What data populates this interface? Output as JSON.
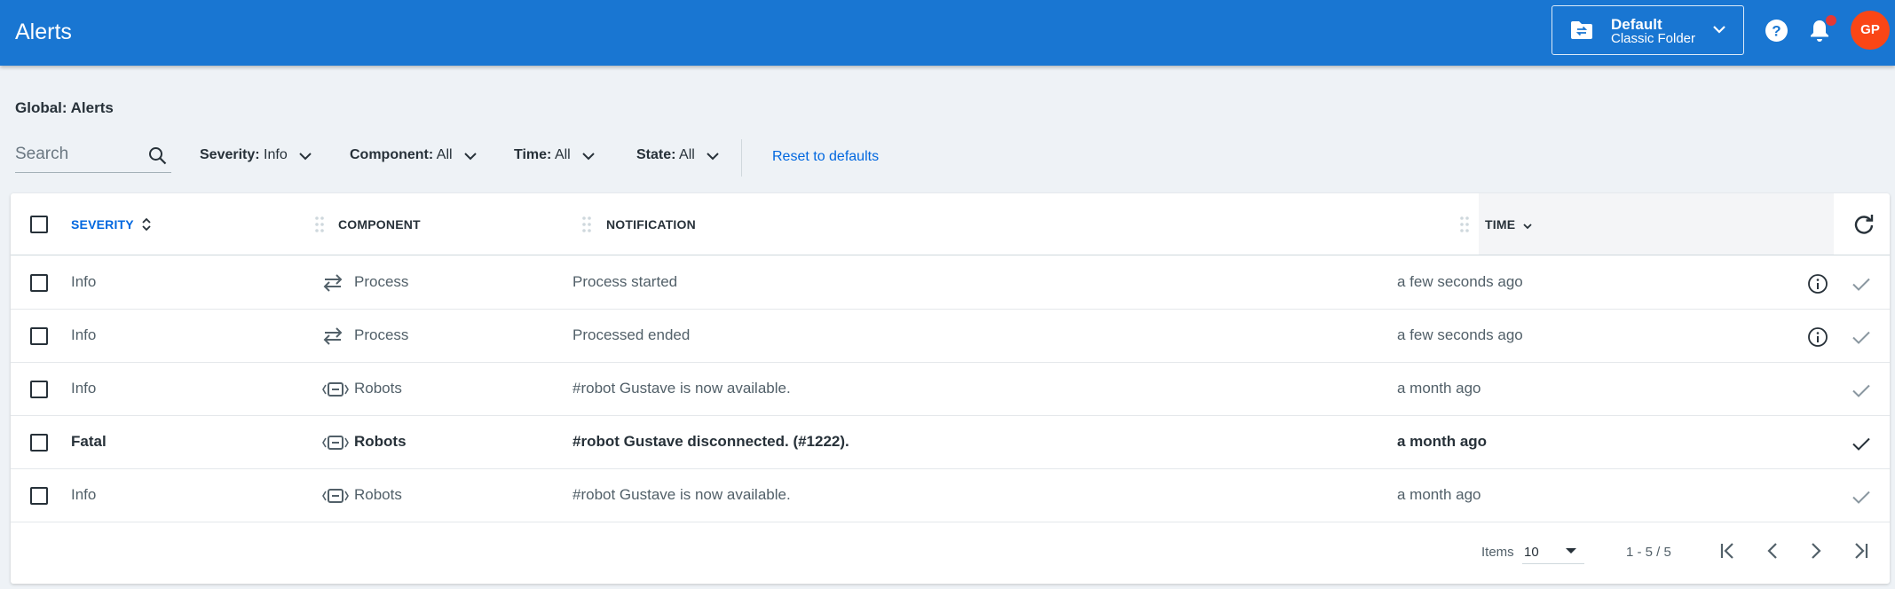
{
  "header": {
    "title": "Alerts",
    "folder": {
      "name": "Default",
      "type": "Classic Folder"
    },
    "avatar_initials": "GP",
    "notification_dot": true,
    "brand_color": "#1976d2",
    "avatar_color": "#fa4616"
  },
  "breadcrumb": "Global: Alerts",
  "filters": {
    "search_placeholder": "Search",
    "severity": {
      "label": "Severity:",
      "value": "Info"
    },
    "component": {
      "label": "Component:",
      "value": "All"
    },
    "time": {
      "label": "Time:",
      "value": "All"
    },
    "state": {
      "label": "State:",
      "value": "All"
    },
    "reset_label": "Reset to defaults"
  },
  "grid": {
    "columns": [
      "SEVERITY",
      "COMPONENT",
      "NOTIFICATION",
      "TIME"
    ],
    "sorted_column": "SEVERITY",
    "rows": [
      {
        "severity": "Info",
        "component": "Process",
        "component_icon": "process-icon",
        "notification": "Process started",
        "time": "a few seconds ago",
        "has_info": true,
        "bold": false
      },
      {
        "severity": "Info",
        "component": "Process",
        "component_icon": "process-icon",
        "notification": "Processed ended",
        "time": "a few seconds ago",
        "has_info": true,
        "bold": false
      },
      {
        "severity": "Info",
        "component": "Robots",
        "component_icon": "robot-icon",
        "notification": "#robot Gustave is now available.",
        "time": "a month ago",
        "has_info": false,
        "bold": false
      },
      {
        "severity": "Fatal",
        "component": "Robots",
        "component_icon": "robot-icon",
        "notification": "#robot Gustave disconnected. (#1222).",
        "time": "a month ago",
        "has_info": false,
        "bold": true
      },
      {
        "severity": "Info",
        "component": "Robots",
        "component_icon": "robot-icon",
        "notification": "#robot Gustave is now available.",
        "time": "a month ago",
        "has_info": false,
        "bold": false
      }
    ]
  },
  "footer": {
    "items_label": "Items",
    "page_size": "10",
    "range": "1 - 5 / 5"
  }
}
